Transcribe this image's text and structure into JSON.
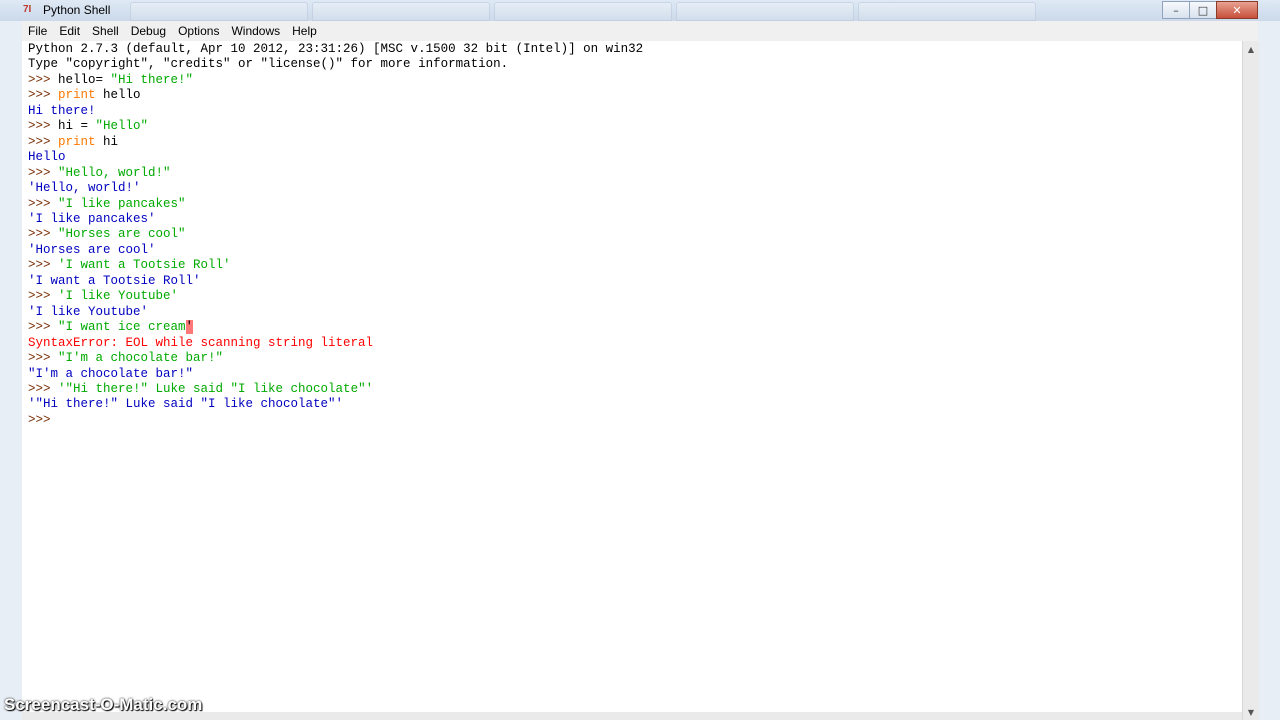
{
  "window": {
    "title": "Python Shell",
    "app_icon": "7Ɩ",
    "controls": {
      "minimize": "–",
      "maximize": "□",
      "close": "✕"
    }
  },
  "menu": [
    "File",
    "Edit",
    "Shell",
    "Debug",
    "Options",
    "Windows",
    "Help"
  ],
  "shell": {
    "banner": [
      "Python 2.7.3 (default, Apr 10 2012, 23:31:26) [MSC v.1500 32 bit (Intel)] on win32",
      "Type \"copyright\", \"credits\" or \"license()\" for more information."
    ],
    "prompt": ">>> ",
    "lines": [
      {
        "type": "input",
        "parts": [
          {
            "t": "plain",
            "v": "hello= "
          },
          {
            "t": "str",
            "v": "\"Hi there!\""
          }
        ]
      },
      {
        "type": "input",
        "parts": [
          {
            "t": "kw",
            "v": "print"
          },
          {
            "t": "plain",
            "v": " hello"
          }
        ]
      },
      {
        "type": "output",
        "text": "Hi there!"
      },
      {
        "type": "input",
        "parts": [
          {
            "t": "plain",
            "v": "hi = "
          },
          {
            "t": "str",
            "v": "\"Hello\""
          }
        ]
      },
      {
        "type": "input",
        "parts": [
          {
            "t": "kw",
            "v": "print"
          },
          {
            "t": "plain",
            "v": " hi"
          }
        ]
      },
      {
        "type": "output",
        "text": "Hello"
      },
      {
        "type": "input",
        "parts": [
          {
            "t": "str",
            "v": "\"Hello, world!\""
          }
        ]
      },
      {
        "type": "output",
        "text": "'Hello, world!'"
      },
      {
        "type": "input",
        "parts": [
          {
            "t": "str",
            "v": "\"I like pancakes\""
          }
        ]
      },
      {
        "type": "output",
        "text": "'I like pancakes'"
      },
      {
        "type": "input",
        "parts": [
          {
            "t": "str",
            "v": "\"Horses are cool\""
          }
        ]
      },
      {
        "type": "output",
        "text": "'Horses are cool'"
      },
      {
        "type": "input",
        "parts": [
          {
            "t": "str",
            "v": "'I want a Tootsie Roll'"
          }
        ]
      },
      {
        "type": "output",
        "text": "'I want a Tootsie Roll'"
      },
      {
        "type": "input",
        "parts": [
          {
            "t": "str",
            "v": "'I like Youtube'"
          }
        ]
      },
      {
        "type": "output",
        "text": "'I like Youtube'"
      },
      {
        "type": "input",
        "parts": [
          {
            "t": "str",
            "v": "\"I want ice cream"
          },
          {
            "t": "errhl",
            "v": "'"
          }
        ]
      },
      {
        "type": "error",
        "text": "SyntaxError: EOL while scanning string literal"
      },
      {
        "type": "input",
        "parts": [
          {
            "t": "str",
            "v": "\"I'm a chocolate bar!\""
          }
        ]
      },
      {
        "type": "output",
        "text": "\"I'm a chocolate bar!\""
      },
      {
        "type": "input",
        "parts": [
          {
            "t": "str",
            "v": "'\"Hi there!\" Luke said \"I like chocolate\"'"
          }
        ]
      },
      {
        "type": "output",
        "text": "'\"Hi there!\" Luke said \"I like chocolate\"'"
      },
      {
        "type": "input",
        "parts": []
      }
    ]
  },
  "scrollbar": {
    "up_arrow": "▲",
    "down_arrow": "▼"
  },
  "watermark": "Screencast-O-Matic.com",
  "colors": {
    "prompt": "#7a2b00",
    "output": "#0000c0",
    "string": "#00aa00",
    "keyword": "#ff7700",
    "error": "#ff0000"
  }
}
